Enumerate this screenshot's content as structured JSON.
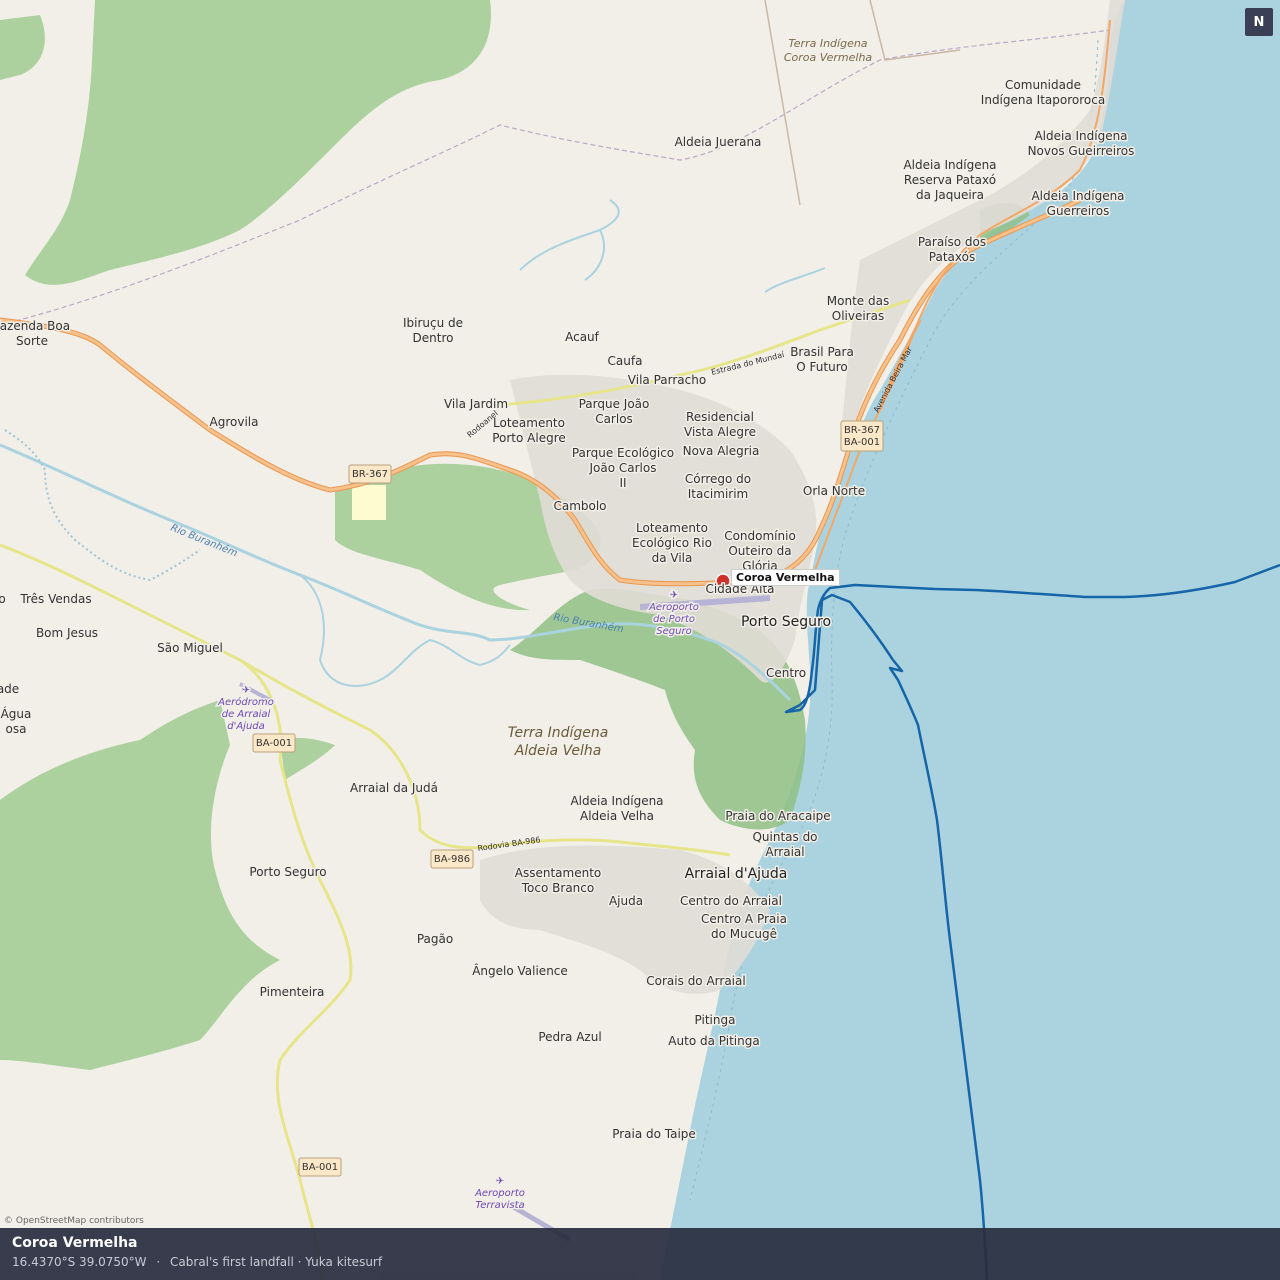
{
  "map": {
    "north_label": "N",
    "attribution": "© OpenStreetMap contributors",
    "colors": {
      "land": "#f2efe9",
      "sea": "#aad3df",
      "forest": "#add19e",
      "wetland": "#8fbf84",
      "track": "#1565a8",
      "pin": "#d1302a",
      "trunk_road": "#f2a766"
    },
    "marker": {
      "label": "Coroa Vermelha",
      "color": "#d1302a"
    },
    "places": [
      {
        "id": "comunidade-indigena",
        "lines": [
          "Comunidade",
          "Indígena Itapororoca"
        ]
      },
      {
        "id": "aldeia-novos",
        "lines": [
          "Aldeia Indígena",
          "Novos Gueirreiros"
        ]
      },
      {
        "id": "aldeia-jaqueira",
        "lines": [
          "Aldeia Indígena",
          "Reserva Pataxó",
          "da Jaqueira"
        ]
      },
      {
        "id": "aldeia-guerreiros",
        "lines": [
          "Aldeia Indígena",
          "Guerreiros"
        ]
      },
      {
        "id": "aldeia-juerana",
        "lines": [
          "Aldeia Juerana"
        ]
      },
      {
        "id": "paraiso",
        "lines": [
          "Paraíso dos",
          "Pataxós"
        ]
      },
      {
        "id": "monte-oliveiras",
        "lines": [
          "Monte das",
          "Oliveiras"
        ]
      },
      {
        "id": "brasil-futuro",
        "lines": [
          "Brasil Para",
          "O Futuro"
        ]
      },
      {
        "id": "fazenda",
        "lines": [
          "Fazenda Boa",
          "Sorte"
        ]
      },
      {
        "id": "ibirucu",
        "lines": [
          "Ibiruçu de",
          "Dentro"
        ]
      },
      {
        "id": "acauf",
        "lines": [
          "Acauf"
        ]
      },
      {
        "id": "caufa",
        "lines": [
          "Caufa"
        ]
      },
      {
        "id": "vila-parracho",
        "lines": [
          "Vila Parracho"
        ]
      },
      {
        "id": "vila-jardim",
        "lines": [
          "Vila Jardim"
        ]
      },
      {
        "id": "parque-joao",
        "lines": [
          "Parque João",
          "Carlos"
        ]
      },
      {
        "id": "residencial",
        "lines": [
          "Residencial",
          "Vista Alegre"
        ]
      },
      {
        "id": "agrovila",
        "lines": [
          "Agrovila"
        ]
      },
      {
        "id": "loteamento-pa",
        "lines": [
          "Loteamento",
          "Porto Alegre"
        ]
      },
      {
        "id": "parque-eco",
        "lines": [
          "Parque Ecológico",
          "João Carlos",
          "II"
        ]
      },
      {
        "id": "nova-alegria",
        "lines": [
          "Nova Alegria"
        ]
      },
      {
        "id": "corrego",
        "lines": [
          "Córrego do",
          "Itacimirim"
        ]
      },
      {
        "id": "orla-norte",
        "lines": [
          "Orla Norte"
        ]
      },
      {
        "id": "cambolo",
        "lines": [
          "Cambolo"
        ]
      },
      {
        "id": "loteamento-eco",
        "lines": [
          "Loteamento",
          "Ecológico Rio",
          "da Vila"
        ]
      },
      {
        "id": "condominio",
        "lines": [
          "Condomínio",
          "Outeiro da",
          "Glória"
        ]
      },
      {
        "id": "cidade-alta",
        "lines": [
          "Cidade Alta"
        ]
      },
      {
        "id": "porto-seguro-city",
        "lines": [
          "Porto Seguro"
        ]
      },
      {
        "id": "centro",
        "lines": [
          "Centro"
        ]
      },
      {
        "id": "tres-vendas",
        "lines": [
          "Três Vendas"
        ]
      },
      {
        "id": "bom-jesus",
        "lines": [
          "Bom Jesus"
        ]
      },
      {
        "id": "sao-miguel",
        "lines": [
          "São Miguel"
        ]
      },
      {
        "id": "edge-ade",
        "lines": [
          "ade"
        ]
      },
      {
        "id": "edge-agua",
        "lines": [
          "Água",
          "osa"
        ]
      },
      {
        "id": "edge-o",
        "lines": [
          "o"
        ]
      },
      {
        "id": "arraial-juda",
        "lines": [
          "Arraial da Judá"
        ]
      },
      {
        "id": "aldeia-velha",
        "lines": [
          "Aldeia Indígena",
          "Aldeia Velha"
        ]
      },
      {
        "id": "praia-aracaipe",
        "lines": [
          "Praia do Aracaipe"
        ]
      },
      {
        "id": "quintas",
        "lines": [
          "Quintas do",
          "Arraial"
        ]
      },
      {
        "id": "porto-seguro-w",
        "lines": [
          "Porto Seguro"
        ]
      },
      {
        "id": "assentamento",
        "lines": [
          "Assentamento",
          "Toco Branco"
        ]
      },
      {
        "id": "arraial-ajuda",
        "lines": [
          "Arraial d'Ajuda"
        ]
      },
      {
        "id": "ajuda",
        "lines": [
          "Ajuda"
        ]
      },
      {
        "id": "centro-arraial",
        "lines": [
          "Centro do Arraial"
        ]
      },
      {
        "id": "centro-praia",
        "lines": [
          "Centro A Praia",
          "do Mucugê"
        ]
      },
      {
        "id": "pagao",
        "lines": [
          "Pagão"
        ]
      },
      {
        "id": "angelo",
        "lines": [
          "Ângelo Valience"
        ]
      },
      {
        "id": "corais",
        "lines": [
          "Corais do Arraial"
        ]
      },
      {
        "id": "pimenteira",
        "lines": [
          "Pimenteira"
        ]
      },
      {
        "id": "pedra-azul",
        "lines": [
          "Pedra Azul"
        ]
      },
      {
        "id": "pitinga",
        "lines": [
          "Pitinga"
        ]
      },
      {
        "id": "auto-pitinga",
        "lines": [
          "Auto da Pitinga"
        ]
      },
      {
        "id": "praia-taipe",
        "lines": [
          "Praia do Taipe"
        ]
      }
    ],
    "areas": [
      {
        "id": "ti-coroa",
        "lines": [
          "Terra Indígena",
          "Coroa Vermelha"
        ]
      },
      {
        "id": "ti-aldeia",
        "lines": [
          "Terra Indígena",
          "Aldeia Velha"
        ]
      }
    ],
    "aerodromes": [
      {
        "id": "aero-ps",
        "lines": [
          "Aeroporto",
          "de Porto",
          "Seguro"
        ]
      },
      {
        "id": "aero-arraial",
        "lines": [
          "Aeródromo",
          "de Arraial",
          "d'Ajuda"
        ]
      },
      {
        "id": "aero-terravista",
        "lines": [
          "Aeroporto",
          "Terravista"
        ]
      }
    ],
    "rivers": [
      {
        "id": "rio-buranhem-1",
        "label": "Rio Buranhém"
      },
      {
        "id": "rio-buranhem-2",
        "label": "Rio Buranhém"
      }
    ],
    "road_labels": [
      {
        "id": "estrada-mundai",
        "label": "Estrada do Mundaí"
      },
      {
        "id": "rodoanel",
        "label": "Rodoanel"
      },
      {
        "id": "avenida-beira-mar",
        "label": "Avenida Beira Mar"
      },
      {
        "id": "rodovia-ba986",
        "label": "Rodovia BA-986"
      }
    ],
    "shields": [
      {
        "id": "shield-br367-w",
        "lines": [
          "BR-367"
        ]
      },
      {
        "id": "shield-br367-e",
        "lines": [
          "BR-367",
          "BA-001"
        ]
      },
      {
        "id": "shield-ba001-a",
        "lines": [
          "BA-001"
        ]
      },
      {
        "id": "shield-ba986",
        "lines": [
          "BA-986"
        ]
      },
      {
        "id": "shield-ba001-b",
        "lines": [
          "BA-001"
        ]
      }
    ]
  },
  "info": {
    "title": "Coroa Vermelha",
    "coords": "16.4370°S  39.0750°W",
    "separator": "·",
    "tags": "Cabral's first landfall · Yuka kitesurf"
  }
}
